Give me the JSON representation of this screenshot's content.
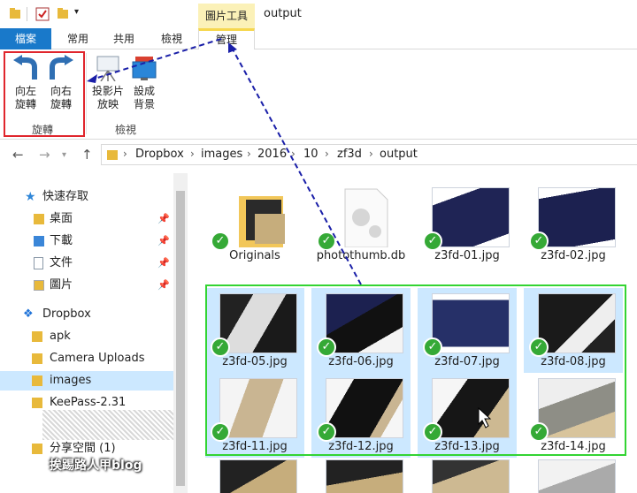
{
  "window": {
    "title": "output",
    "context_tab": "圖片工具"
  },
  "tabs": [
    {
      "label": "檔案"
    },
    {
      "label": "常用"
    },
    {
      "label": "共用"
    },
    {
      "label": "檢視"
    },
    {
      "label": "管理"
    }
  ],
  "ribbon": {
    "rotate_left": "向左\n旋轉",
    "rotate_right": "向右\n旋轉",
    "rotate_group": "旋轉",
    "slideshow": "投影片\n放映",
    "set_background": "設成\n背景",
    "view_group": "檢視"
  },
  "address": {
    "crumbs": [
      "Dropbox",
      "images",
      "2016",
      "10",
      "zf3d",
      "output"
    ]
  },
  "nav": {
    "quick_access": "快速存取",
    "items": [
      {
        "label": "桌面"
      },
      {
        "label": "下載"
      },
      {
        "label": "文件"
      },
      {
        "label": "圖片"
      },
      {
        "label": "Dropbox"
      },
      {
        "label": "apk"
      },
      {
        "label": "Camera Uploads"
      },
      {
        "label": "images"
      },
      {
        "label": "KeePass-2.31"
      },
      {
        "label": "分享空間 (1)"
      }
    ]
  },
  "files": [
    {
      "name": "Originals"
    },
    {
      "name": "photothumb.db"
    },
    {
      "name": "z3fd-01.jpg"
    },
    {
      "name": "z3fd-02.jpg"
    },
    {
      "name": "z3fd-05.jpg"
    },
    {
      "name": "z3fd-06.jpg"
    },
    {
      "name": "z3fd-07.jpg"
    },
    {
      "name": "z3fd-08.jpg"
    },
    {
      "name": "z3fd-11.jpg"
    },
    {
      "name": "z3fd-12.jpg"
    },
    {
      "name": "z3fd-13.jpg"
    },
    {
      "name": "z3fd-14.jpg"
    }
  ],
  "watermark": "挨踢路人甲blog",
  "colors": {
    "file_tab": "#1979ca",
    "selection": "#cce8ff",
    "sync_check": "#35a936",
    "highlight_red": "#e0262d",
    "highlight_green": "#33d433",
    "context_tab": "#fbf1b8"
  }
}
